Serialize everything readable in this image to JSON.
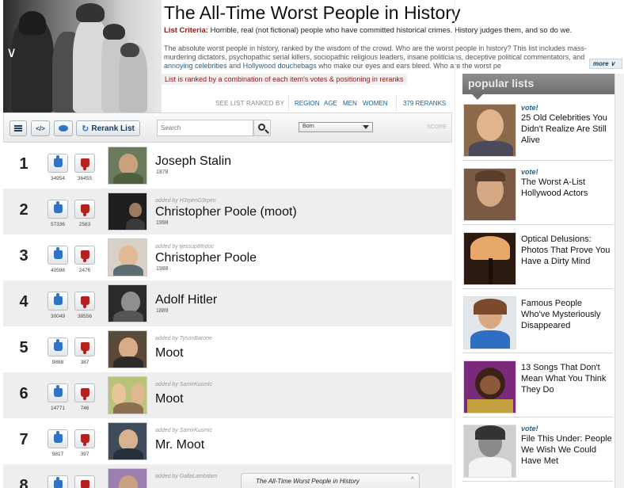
{
  "header": {
    "title": "The All-Time Worst People in History",
    "criteria_label": "List Criteria:",
    "criteria_text": "Horrible, real (not fictional) people who have committed historical crimes. History judges them, and so do we.",
    "description_a": "The absolute worst people in history, ranked by the wisdom of the crowd. Who are the worst people in history? This list includes mass-murdering dictators, psychopathic serial killers, sociopathic religious leaders, insane politicians, deceptive political commentators, and",
    "description_link1": "annoying celebrities",
    "description_and": "and",
    "description_link2": "Hollywood douchebags",
    "description_b": "who make our eyes and ears bleed. Who are the worst pe",
    "more_label": "more",
    "ranked_note": "List is ranked by a combination of each item's votes & positioning in reranks"
  },
  "rankbar": {
    "label": "SEE LIST RANKED BY",
    "region": "REGION",
    "age": "AGE",
    "men": "MEN",
    "women": "WOMEN",
    "reranks": "379 RERANKS"
  },
  "toolbar": {
    "embed_label": "</>",
    "rerank_label": "Rerank List",
    "search_placeholder": "Search",
    "select_value": "Born",
    "score_label": "SCORE"
  },
  "list": [
    {
      "rank": "1",
      "up": "34954",
      "down": "36455",
      "added_by": "",
      "name": "Joseph Stalin",
      "year": "1878"
    },
    {
      "rank": "2",
      "up": "57336",
      "down": "2583",
      "added_by": "added by H3rpenD3rpen",
      "name": "Christopher Poole (moot)",
      "year": "1998"
    },
    {
      "rank": "3",
      "up": "40598",
      "down": "2476",
      "added_by": "added by tjessup8thdoc",
      "name": "Christopher Poole",
      "year": "1988"
    },
    {
      "rank": "4",
      "up": "30049",
      "down": "38556",
      "added_by": "",
      "name": "Adolf Hitler",
      "year": "1889"
    },
    {
      "rank": "5",
      "up": "9888",
      "down": "387",
      "added_by": "added by TysonBarone",
      "name": "Moot",
      "year": ""
    },
    {
      "rank": "6",
      "up": "14771",
      "down": "746",
      "added_by": "added by SamirKusmic",
      "name": "Moot",
      "year": ""
    },
    {
      "rank": "7",
      "up": "9817",
      "down": "397",
      "added_by": "added by SamirKusmic",
      "name": "Mr. Moot",
      "year": ""
    },
    {
      "rank": "8",
      "up": "",
      "down": "",
      "added_by": "added by GallaLambdam",
      "name": "",
      "year": ""
    }
  ],
  "sidebar": {
    "header": "popular lists",
    "items": [
      {
        "vote": "vote!",
        "title": "25 Old Celebrities You Didn't Realize Are Still Alive"
      },
      {
        "vote": "vote!",
        "title": "The Worst A-List Hollywood Actors"
      },
      {
        "vote": "",
        "title": "Optical Delusions: Photos That Prove You Have a Dirty Mind"
      },
      {
        "vote": "",
        "title": "Famous People Who've Mysteriously Disappeared"
      },
      {
        "vote": "",
        "title": "13 Songs That Don't Mean What You Think They Do"
      },
      {
        "vote": "vote!",
        "title": "File This Under: People We Wish We Could Have Met"
      }
    ]
  },
  "footer": {
    "tab_title": "The All-Time Worst People in History",
    "tab_icon": "chevron-up-icon"
  },
  "colors": {
    "accent_blue": "#24628e",
    "accent_red": "#8c1b1b",
    "thumb_up": "#2f73c2",
    "thumb_down": "#b5221d"
  }
}
